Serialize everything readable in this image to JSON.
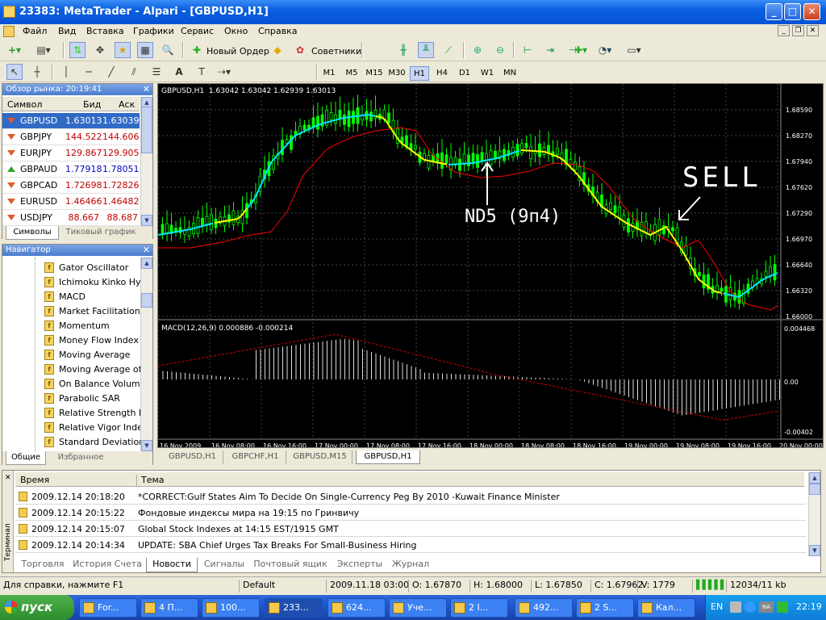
{
  "window": {
    "title": "23383: MetaTrader - Alpari - [GBPUSD,H1]"
  },
  "menu": [
    "Файл",
    "Вид",
    "Вставка",
    "Графики",
    "Сервис",
    "Окно",
    "Справка"
  ],
  "toolbar": {
    "new_order": "Новый Ордер",
    "advisors": "Советники",
    "timeframes": [
      "M1",
      "M5",
      "M15",
      "M30",
      "H1",
      "H4",
      "D1",
      "W1",
      "MN"
    ],
    "active_tf": "H1"
  },
  "market_watch": {
    "title": "Обзор рынка: 20:19:41",
    "headers": {
      "symbol": "Символ",
      "bid": "Бид",
      "ask": "Аск"
    },
    "rows": [
      {
        "symbol": "GBPUSD",
        "bid": "1.63013",
        "ask": "1.63039",
        "dir": "down",
        "color": "#000000"
      },
      {
        "symbol": "GBPJPY",
        "bid": "144.522",
        "ask": "144.606",
        "dir": "down",
        "color": "#c00000"
      },
      {
        "symbol": "EURJPY",
        "bid": "129.867",
        "ask": "129.905",
        "dir": "down",
        "color": "#c00000"
      },
      {
        "symbol": "GBPAUD",
        "bid": "1.77918",
        "ask": "1.78051",
        "dir": "up",
        "color": "#0000c0"
      },
      {
        "symbol": "GBPCAD",
        "bid": "1.72698",
        "ask": "1.72826",
        "dir": "down",
        "color": "#c00000"
      },
      {
        "symbol": "EURUSD",
        "bid": "1.46466",
        "ask": "1.46482",
        "dir": "down",
        "color": "#c00000"
      },
      {
        "symbol": "USDJPY",
        "bid": "88.667",
        "ask": "88.687",
        "dir": "down",
        "color": "#c00000"
      }
    ],
    "tabs": [
      "Символы",
      "Тиковый график"
    ]
  },
  "navigator": {
    "title": "Навигатор",
    "items": [
      "Gator Oscillator",
      "Ichimoku Kinko Hyo",
      "MACD",
      "Market Facilitation In",
      "Momentum",
      "Money Flow Index",
      "Moving Average",
      "Moving Average of O",
      "On Balance Volume",
      "Parabolic SAR",
      "Relative Strength In",
      "Relative Vigor Index",
      "Standard Deviation"
    ],
    "tabs": [
      "Общие",
      "Избранное"
    ]
  },
  "chart": {
    "header": "GBPUSD,H1  1.63042 1.63042 1.62939 1.63013",
    "price_ticks": [
      "1.68590",
      "1.68270",
      "1.67940",
      "1.67620",
      "1.67290",
      "1.66970",
      "1.66640",
      "1.66320",
      "1.66000"
    ],
    "macd_header": "MACD(12,26,9) 0.000886 -0.000214",
    "macd_ticks": [
      "0.004468",
      "0.00",
      "-0.00402"
    ],
    "time_ticks": [
      "16 Nov 2009",
      "16 Nov 08:00",
      "16 Nov 16:00",
      "17 Nov 00:00",
      "17 Nov 08:00",
      "17 Nov 16:00",
      "18 Nov 00:00",
      "18 Nov 08:00",
      "18 Nov 16:00",
      "19 Nov 00:00",
      "19 Nov 08:00",
      "19 Nov 16:00",
      "20 Nov 00:00"
    ],
    "annotation_sell": "SELL",
    "annotation_nd": "ND5 (9п4)",
    "tabs": [
      "GBPUSD,H1",
      "GBPCHF,H1",
      "GBPUSD,M15",
      "GBPUSD,H1"
    ]
  },
  "terminal": {
    "side_label": "Терминал",
    "headers": {
      "time": "Время",
      "topic": "Тема"
    },
    "rows": [
      {
        "time": "2009.12.14 20:18:20",
        "topic": "*CORRECT:Gulf States Aim To Decide On Single-Currency Peg By 2010 -Kuwait Finance Minister"
      },
      {
        "time": "2009.12.14 20:15:22",
        "topic": "Фондовые индексы мира на 19:15 по Гринвичу"
      },
      {
        "time": "2009.12.14 20:15:07",
        "topic": "Global Stock Indexes at 14:15 EST/1915 GMT"
      },
      {
        "time": "2009.12.14 20:14:34",
        "topic": "UPDATE: SBA Chief Urges Tax Breaks For Small-Business Hiring"
      }
    ],
    "tabs": [
      "Торговля",
      "История Счета",
      "Новости",
      "Сигналы",
      "Почтовый ящик",
      "Эксперты",
      "Журнал"
    ],
    "active_tab": "Новости"
  },
  "status": {
    "help": "Для справки, нажмите F1",
    "profile": "Default",
    "datetime": "2009.11.18 03:00",
    "open": "O: 1.67870",
    "high": "H: 1.68000",
    "low": "L: 1.67850",
    "close": "C: 1.67962",
    "volume": "V: 1779",
    "traffic": "12034/11 kb"
  },
  "taskbar": {
    "start": "пуск",
    "tasks": [
      "For...",
      "4 П...",
      "100...",
      "233...",
      "624...",
      "Уче...",
      "2 I...",
      "492...",
      "2 S...",
      "Кал..."
    ],
    "lang": "EN",
    "clock": "22:19"
  },
  "colors": {
    "bull": "#00ff00",
    "bear": "#ffffff",
    "ma_fast": "#ffff00",
    "ma_cyan": "#00e5ff",
    "ma_slow": "#ff0000"
  }
}
